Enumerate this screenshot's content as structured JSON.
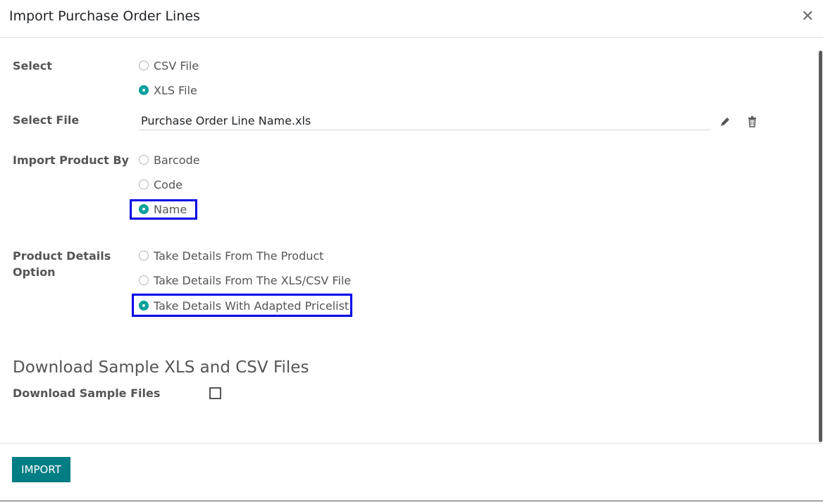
{
  "dialog": {
    "title": "Import Purchase Order Lines",
    "close_glyph": "✕"
  },
  "select": {
    "label": "Select",
    "options": [
      {
        "label": "CSV File",
        "checked": false
      },
      {
        "label": "XLS File",
        "checked": true
      }
    ]
  },
  "select_file": {
    "label": "Select File",
    "value": "Purchase Order Line Name.xls"
  },
  "import_by": {
    "label": "Import Product By",
    "options": [
      {
        "label": "Barcode",
        "checked": false
      },
      {
        "label": "Code",
        "checked": false
      },
      {
        "label": "Name",
        "checked": true
      }
    ]
  },
  "details": {
    "label_line1": "Product Details",
    "label_line2": "Option",
    "options": [
      {
        "label": "Take Details From The Product",
        "checked": false
      },
      {
        "label": "Take Details From The XLS/CSV File",
        "checked": false
      },
      {
        "label": "Take Details With Adapted Pricelist",
        "checked": true
      }
    ]
  },
  "sample": {
    "section_title": "Download Sample XLS and CSV Files",
    "label": "Download Sample Files",
    "checked": false
  },
  "footer": {
    "import_label": "IMPORT"
  },
  "colors": {
    "accent": "#00a09d",
    "button": "#017e84",
    "highlight": "#0000e6"
  }
}
